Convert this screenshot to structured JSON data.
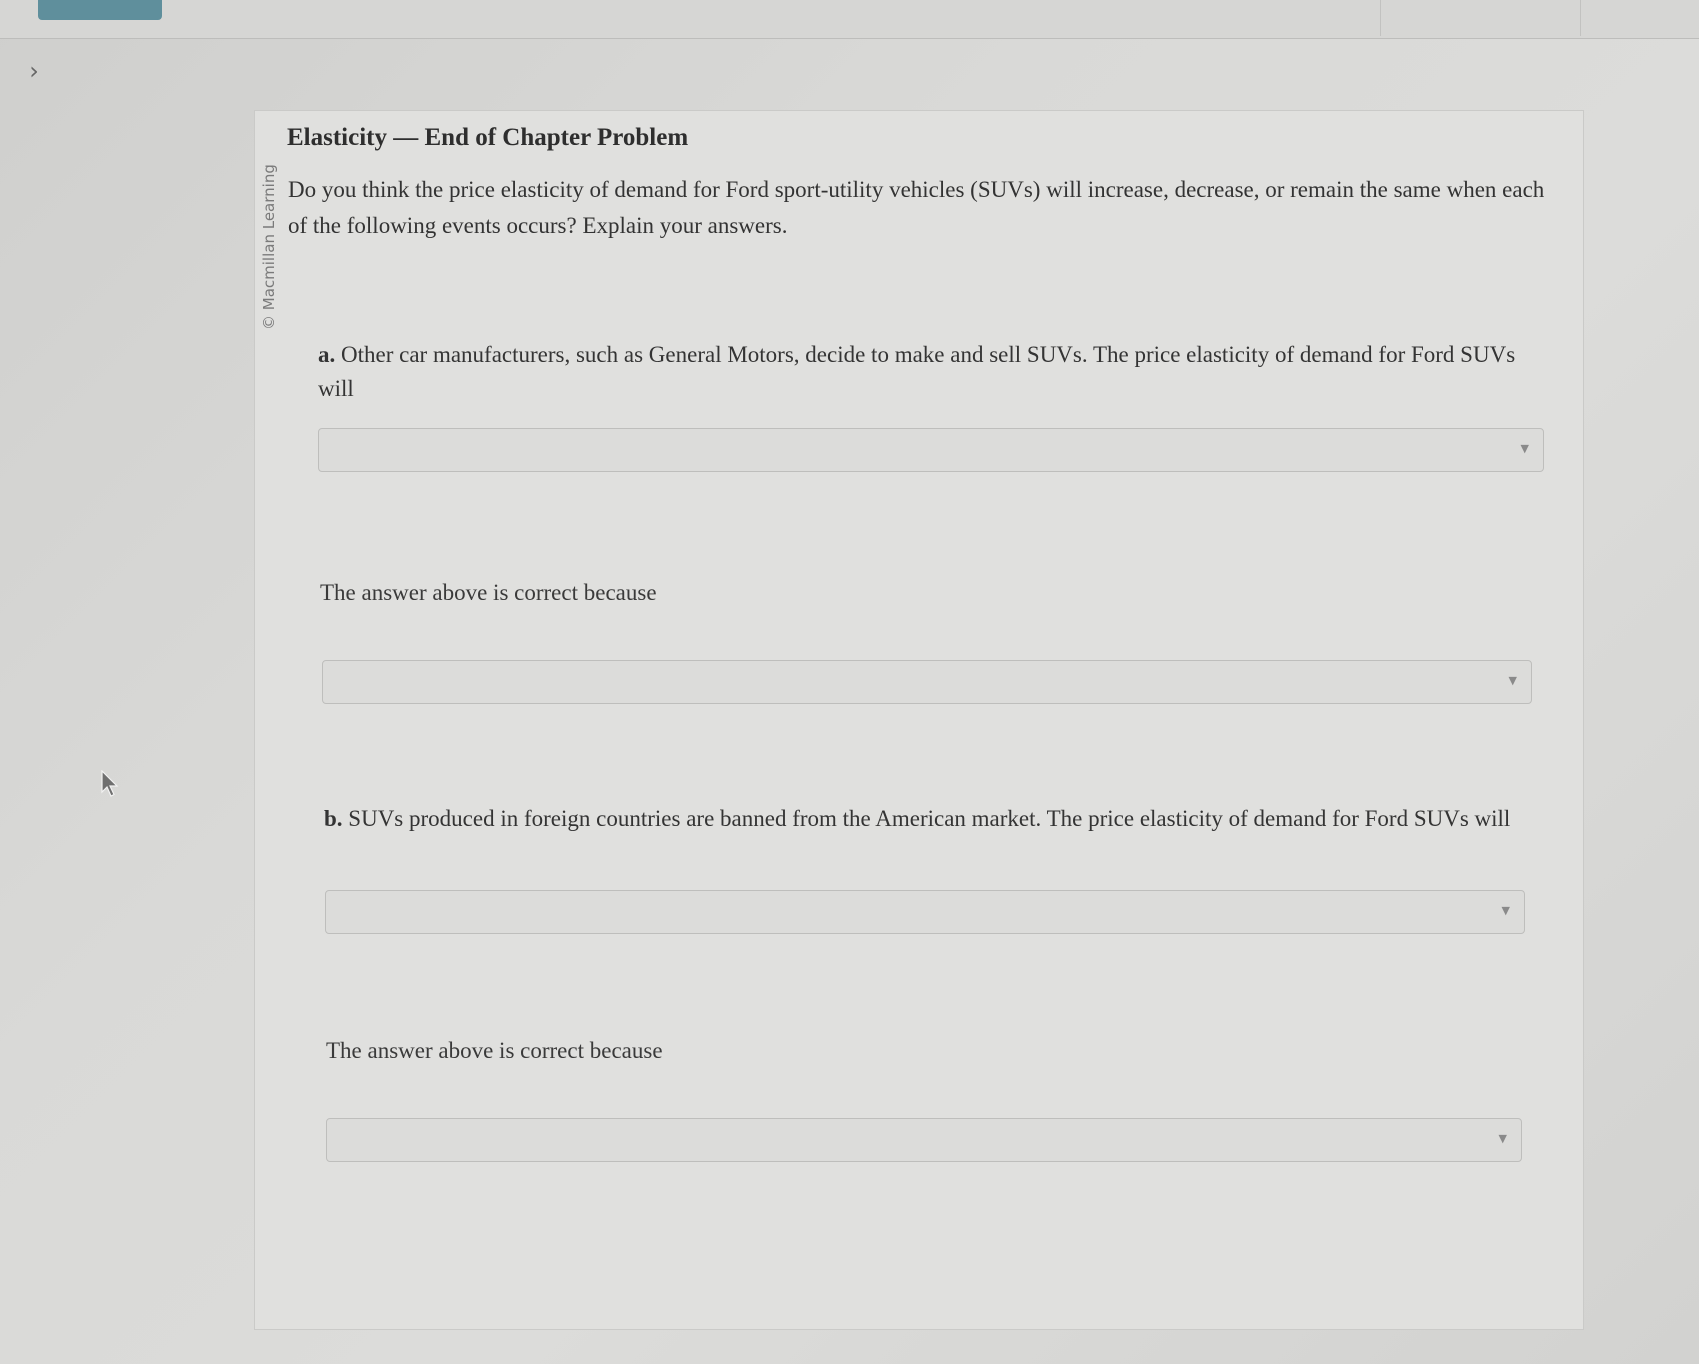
{
  "header": {
    "score_label": ""
  },
  "nav": {
    "expand_icon": "chevron-right-icon"
  },
  "problem": {
    "credit": "© Macmillan Learning",
    "title": "Elasticity — End of Chapter Problem",
    "prompt": "Do you think the price elasticity of demand for Ford sport-utility vehicles (SUVs) will increase, decrease, or remain the same when each of the following events occurs? Explain your answers.",
    "parts": [
      {
        "letter": "a.",
        "question": " Other car manufacturers, such as General Motors, decide to make and sell SUVs. The price elasticity of demand for Ford SUVs will",
        "answer_value": "",
        "because_label": "The answer above is correct because",
        "because_value": ""
      },
      {
        "letter": "b.",
        "question": " SUVs produced in foreign countries are banned from the American market. The price elasticity of demand for Ford SUVs will",
        "answer_value": "",
        "because_label": "The answer above is correct because",
        "because_value": ""
      }
    ]
  },
  "colors": {
    "score_tab": "#5f8f9c",
    "card_background": "#e0e0de",
    "dropdown_background": "#dcdcda"
  }
}
